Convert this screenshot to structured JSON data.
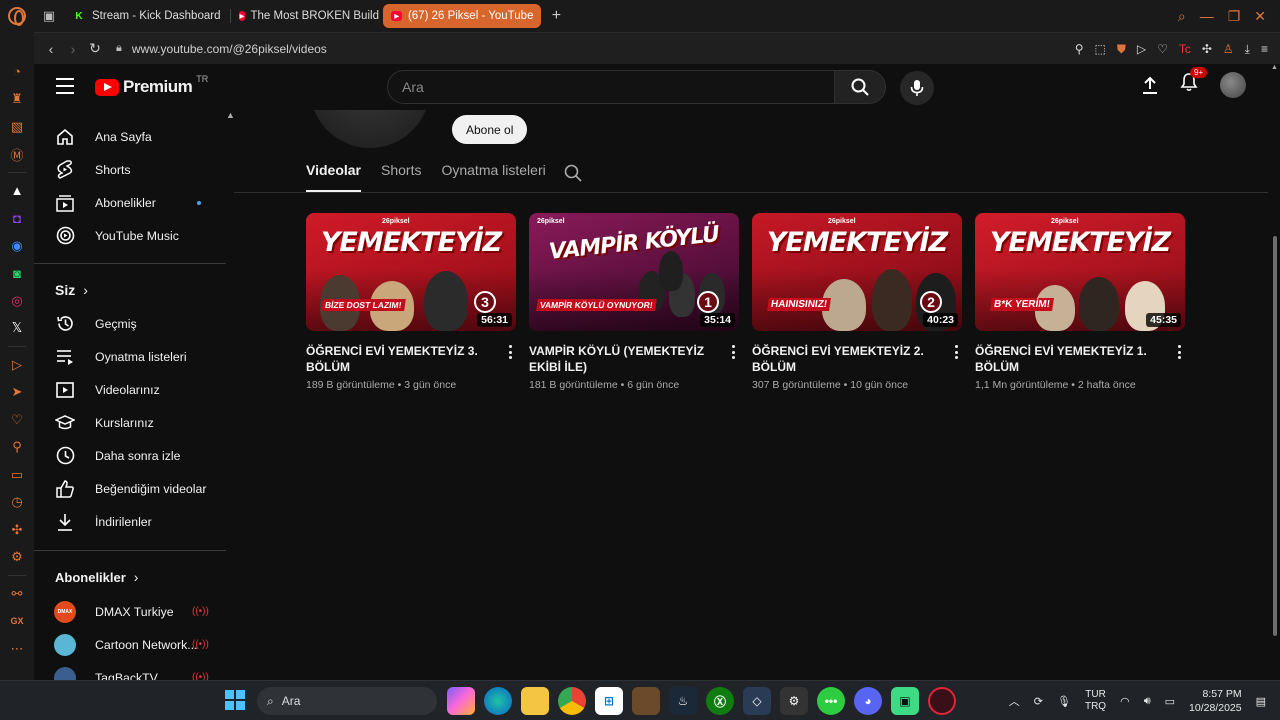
{
  "browser": {
    "tabs": [
      {
        "label": "Stream - Kick Dashboard",
        "favicon": "kick-icon",
        "color": "#53fc18"
      },
      {
        "label": "The Most BROKEN Build",
        "favicon": "youtube-icon",
        "color": "#ff0033"
      },
      {
        "label": "(67) 26 Piksel - YouTube",
        "favicon": "youtube-icon",
        "color": "#ff0033",
        "active": true
      }
    ],
    "new_tab": "+",
    "url": "www.youtube.com/@26piksel/videos",
    "accent": "#d8652c"
  },
  "youtube": {
    "logo_text": "Premium",
    "country_code": "TR",
    "search_placeholder": "Ara",
    "notification_count": "9+",
    "subscribe_label": "Abone ol",
    "channel_tabs": [
      "Videolar",
      "Shorts",
      "Oynatma listeleri"
    ],
    "sidebar": {
      "main": [
        {
          "label": "Ana Sayfa",
          "icon": "home-icon"
        },
        {
          "label": "Shorts",
          "icon": "shorts-icon"
        },
        {
          "label": "Abonelikler",
          "icon": "subscriptions-icon"
        },
        {
          "label": "YouTube Music",
          "icon": "youtube-music-icon"
        }
      ],
      "you_header": "Siz",
      "you": [
        {
          "label": "Geçmiş",
          "icon": "history-icon"
        },
        {
          "label": "Oynatma listeleri",
          "icon": "playlists-icon"
        },
        {
          "label": "Videolarınız",
          "icon": "your-videos-icon"
        },
        {
          "label": "Kurslarınız",
          "icon": "courses-icon"
        },
        {
          "label": "Daha sonra izle",
          "icon": "watch-later-icon"
        },
        {
          "label": "Beğendiğim videolar",
          "icon": "liked-icon"
        },
        {
          "label": "İndirilenler",
          "icon": "downloads-icon"
        }
      ],
      "subs_header": "Abonelikler",
      "subscriptions": [
        {
          "label": "DMAX Turkiye",
          "avatar_color": "#e04a1c"
        },
        {
          "label": "Cartoon Network...",
          "avatar_color": "#5bb6d6"
        },
        {
          "label": "TagBackTV",
          "avatar_color": "#3a5f8f"
        }
      ]
    },
    "videos": [
      {
        "title": "ÖĞRENCİ EVİ YEMEKTEYİZ 3. BÖLÜM",
        "meta": "189 B görüntüleme • 3 gün önce",
        "duration": "56:31",
        "thumb_title": "YEMEKTEYİZ",
        "thumb_tagline": "BİZE DOST LAZIM!",
        "episode": "3",
        "bg": "#b0101e"
      },
      {
        "title": "VAMPİR KÖYLÜ (YEMEKTEYİZ EKİBİ İLE)",
        "meta": "181 B görüntüleme • 6 gün önce",
        "duration": "35:14",
        "thumb_title": "VAMPİR KÖYLÜ",
        "thumb_tagline": "VAMPİR KÖYLÜ OYNUYOR!",
        "episode": "1",
        "bg": "#6a0f4a"
      },
      {
        "title": "ÖĞRENCİ EVİ YEMEKTEYİZ 2. BÖLÜM",
        "meta": "307 B görüntüleme • 10 gün önce",
        "duration": "40:23",
        "thumb_title": "YEMEKTEYİZ",
        "thumb_tagline": "HAINISINIZ!",
        "episode": "2",
        "bg": "#a80e1c"
      },
      {
        "title": "ÖĞRENCİ EVİ YEMEKTEYİZ 1. BÖLÜM",
        "meta": "1,1 Mn görüntüleme • 2 hafta önce",
        "duration": "45:35",
        "thumb_title": "YEMEKTEYİZ",
        "thumb_tagline": "B*K YERİM!",
        "episode": "",
        "bg": "#b5121f"
      }
    ]
  },
  "taskbar": {
    "search_placeholder": "Ara",
    "lang_top": "TUR",
    "lang_bottom": "TRQ",
    "time": "8:57 PM",
    "date": "10/28/2025"
  }
}
